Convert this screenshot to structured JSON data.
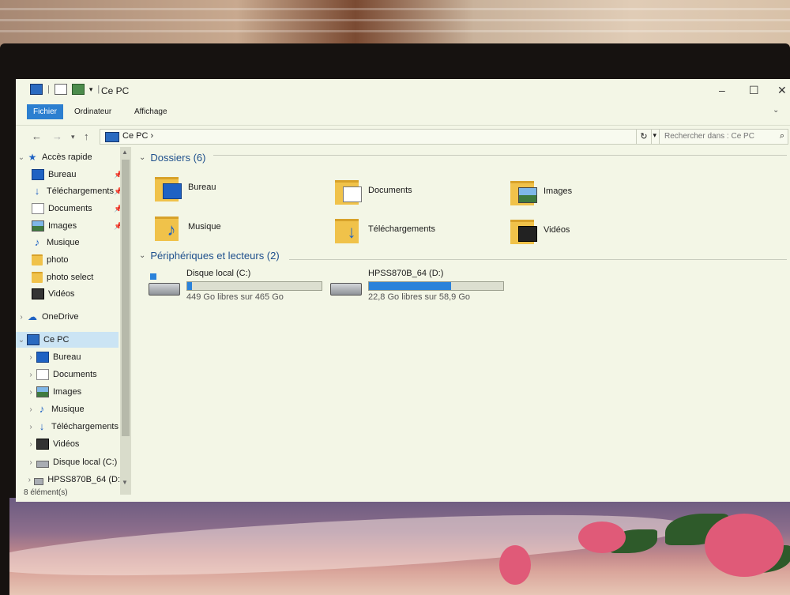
{
  "window": {
    "title": "Ce PC",
    "ribbon_tabs": [
      "Fichier",
      "Ordinateur",
      "Affichage"
    ],
    "controls": [
      "–",
      "☐",
      "✕"
    ]
  },
  "address": {
    "crumb": "Ce PC ›",
    "search_placeholder": "Rechercher dans : Ce PC"
  },
  "sidebar": {
    "quick_access": "Accès rapide",
    "quick_items": [
      {
        "label": "Bureau",
        "icon": "desktop-icon",
        "pinned": true
      },
      {
        "label": "Téléchargements",
        "icon": "download-icon",
        "pinned": true
      },
      {
        "label": "Documents",
        "icon": "document-icon",
        "pinned": true
      },
      {
        "label": "Images",
        "icon": "image-icon",
        "pinned": true
      },
      {
        "label": "Musique",
        "icon": "music-icon",
        "pinned": false
      },
      {
        "label": "photo",
        "icon": "folder-icon",
        "pinned": false
      },
      {
        "label": "photo select",
        "icon": "folder-icon",
        "pinned": false
      },
      {
        "label": "Vidéos",
        "icon": "video-icon",
        "pinned": false
      }
    ],
    "onedrive": "OneDrive",
    "this_pc": "Ce PC",
    "pc_items": [
      {
        "label": "Bureau",
        "icon": "desktop-icon"
      },
      {
        "label": "Documents",
        "icon": "document-icon"
      },
      {
        "label": "Images",
        "icon": "image-icon"
      },
      {
        "label": "Musique",
        "icon": "music-icon"
      },
      {
        "label": "Téléchargements",
        "icon": "download-icon"
      },
      {
        "label": "Vidéos",
        "icon": "video-icon"
      },
      {
        "label": "Disque local (C:)",
        "icon": "drive-icon"
      },
      {
        "label": "HPSS870B_64 (D:",
        "icon": "drive-icon"
      }
    ]
  },
  "content": {
    "folders_header": "Dossiers (6)",
    "folders": [
      {
        "label": "Bureau",
        "icon": "desktop-icon"
      },
      {
        "label": "Documents",
        "icon": "document-icon"
      },
      {
        "label": "Images",
        "icon": "image-icon"
      },
      {
        "label": "Musique",
        "icon": "music-icon"
      },
      {
        "label": "Téléchargements",
        "icon": "download-icon"
      },
      {
        "label": "Vidéos",
        "icon": "video-icon"
      }
    ],
    "devices_header": "Périphériques et lecteurs (2)",
    "drives": [
      {
        "name": "Disque local (C:)",
        "free": "449 Go libres sur 465 Go",
        "used_fraction": 0.034
      },
      {
        "name": "HPSS870B_64 (D:)",
        "free": "22,8 Go libres sur 58,9 Go",
        "used_fraction": 0.61
      }
    ]
  },
  "status": {
    "count": "8 élément(s)"
  }
}
